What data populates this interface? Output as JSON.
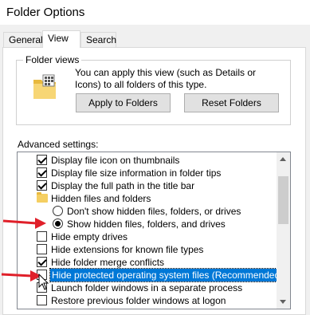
{
  "window": {
    "title": "Folder Options"
  },
  "tabs": [
    {
      "label": "General"
    },
    {
      "label": "View"
    },
    {
      "label": "Search"
    }
  ],
  "folder_views": {
    "label": "Folder views",
    "description": "You can apply this view (such as Details or Icons) to all folders of this type.",
    "apply_button": "Apply to Folders",
    "reset_button": "Reset Folders"
  },
  "advanced": {
    "label": "Advanced settings:",
    "items": [
      {
        "type": "checkbox",
        "checked": true,
        "label": "Display file icon on thumbnails"
      },
      {
        "type": "checkbox",
        "checked": true,
        "label": "Display file size information in folder tips"
      },
      {
        "type": "checkbox",
        "checked": true,
        "label": "Display the full path in the title bar"
      },
      {
        "type": "folder",
        "label": "Hidden files and folders"
      },
      {
        "type": "radio",
        "checked": false,
        "label": "Don't show hidden files, folders, or drives"
      },
      {
        "type": "radio",
        "checked": true,
        "label": "Show hidden files, folders, and drives"
      },
      {
        "type": "checkbox",
        "checked": false,
        "label": "Hide empty drives"
      },
      {
        "type": "checkbox",
        "checked": false,
        "label": "Hide extensions for known file types"
      },
      {
        "type": "checkbox",
        "checked": true,
        "label": "Hide folder merge conflicts"
      },
      {
        "type": "checkbox",
        "checked": false,
        "label": "Hide protected operating system files (Recommended)",
        "selected": true
      },
      {
        "type": "checkbox",
        "checked": false,
        "label": "Launch folder windows in a separate process"
      },
      {
        "type": "checkbox",
        "checked": false,
        "label": "Restore previous folder windows at logon"
      }
    ]
  },
  "colors": {
    "selection": "#0078d7",
    "annotation_arrow": "#e0202a"
  }
}
